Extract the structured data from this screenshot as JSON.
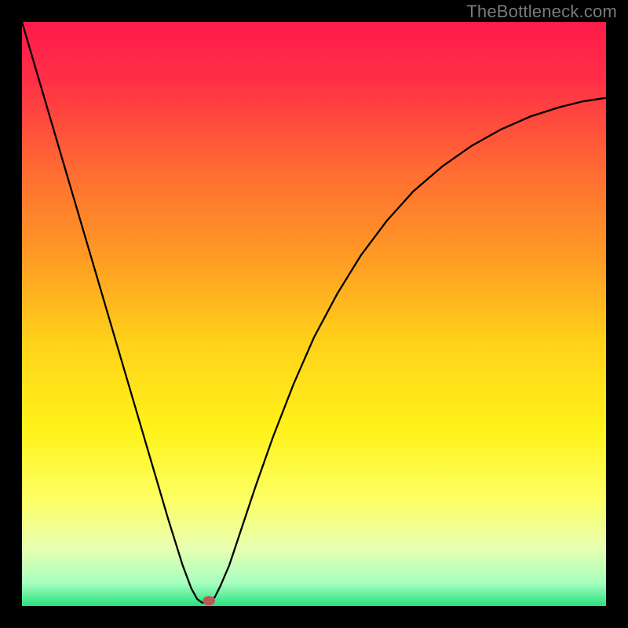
{
  "watermark": "TheBottleneck.com",
  "chart_data": {
    "type": "line",
    "title": "",
    "xlabel": "",
    "ylabel": "",
    "xlim": [
      0,
      100
    ],
    "ylim": [
      0,
      100
    ],
    "gradient_stops": [
      {
        "offset": 0.0,
        "color": "#ff1a4b"
      },
      {
        "offset": 0.1,
        "color": "#ff2f46"
      },
      {
        "offset": 0.25,
        "color": "#ff6a33"
      },
      {
        "offset": 0.4,
        "color": "#ff9a24"
      },
      {
        "offset": 0.55,
        "color": "#ffd21a"
      },
      {
        "offset": 0.7,
        "color": "#fff31a"
      },
      {
        "offset": 0.82,
        "color": "#fcff66"
      },
      {
        "offset": 0.9,
        "color": "#e8ffb0"
      },
      {
        "offset": 0.96,
        "color": "#a8ffc0"
      },
      {
        "offset": 1.0,
        "color": "#29e07f"
      }
    ],
    "series": [
      {
        "name": "bottleneck-curve",
        "x": [
          0.0,
          2.5,
          5.0,
          7.5,
          10.0,
          12.5,
          15.0,
          17.5,
          20.0,
          22.5,
          25.0,
          27.5,
          29.0,
          30.0,
          30.8,
          31.5,
          32.0,
          33.0,
          34.0,
          35.5,
          37.5,
          40.0,
          43.0,
          46.5,
          50.0,
          54.0,
          58.0,
          62.5,
          67.0,
          72.0,
          77.0,
          82.0,
          87.0,
          92.0,
          96.0,
          100.0
        ],
        "y": [
          100.0,
          91.5,
          83.0,
          74.5,
          66.0,
          57.5,
          49.0,
          40.5,
          32.0,
          23.5,
          15.0,
          7.0,
          3.0,
          1.2,
          0.6,
          0.5,
          0.6,
          1.5,
          3.5,
          7.0,
          13.0,
          20.5,
          29.0,
          38.0,
          46.0,
          53.5,
          60.0,
          66.0,
          71.0,
          75.3,
          78.8,
          81.6,
          83.8,
          85.4,
          86.4,
          87.0
        ]
      }
    ],
    "marker": {
      "x": 32.0,
      "y": 0.9,
      "color": "#b65b54"
    }
  }
}
